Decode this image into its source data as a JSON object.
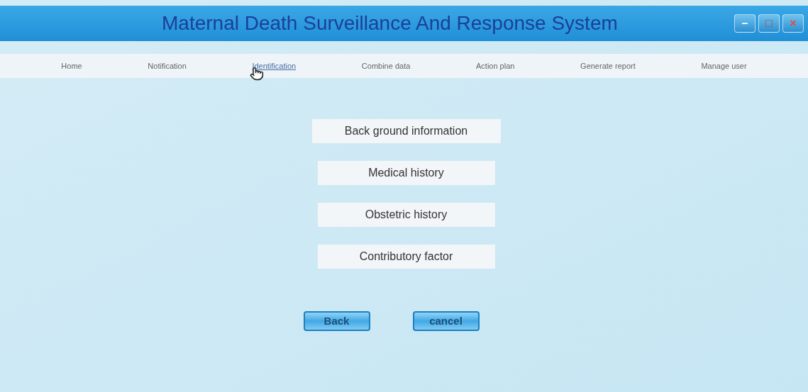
{
  "window": {
    "title": "Maternal Death Surveillance And Response System",
    "controls": [
      "–",
      "□",
      "×"
    ]
  },
  "menu": [
    {
      "label": "Home",
      "selected": false
    },
    {
      "label": "Notification",
      "selected": false
    },
    {
      "label": "Identification",
      "selected": true
    },
    {
      "label": "Combine data",
      "selected": false
    },
    {
      "label": "Action plan",
      "selected": false
    },
    {
      "label": "Generate report",
      "selected": false
    },
    {
      "label": "Manage user",
      "selected": false
    }
  ],
  "options": [
    "Back ground information",
    "Medical history",
    "Obstetric history",
    "Contributory factor"
  ],
  "buttons": [
    "Back",
    "cancel"
  ]
}
